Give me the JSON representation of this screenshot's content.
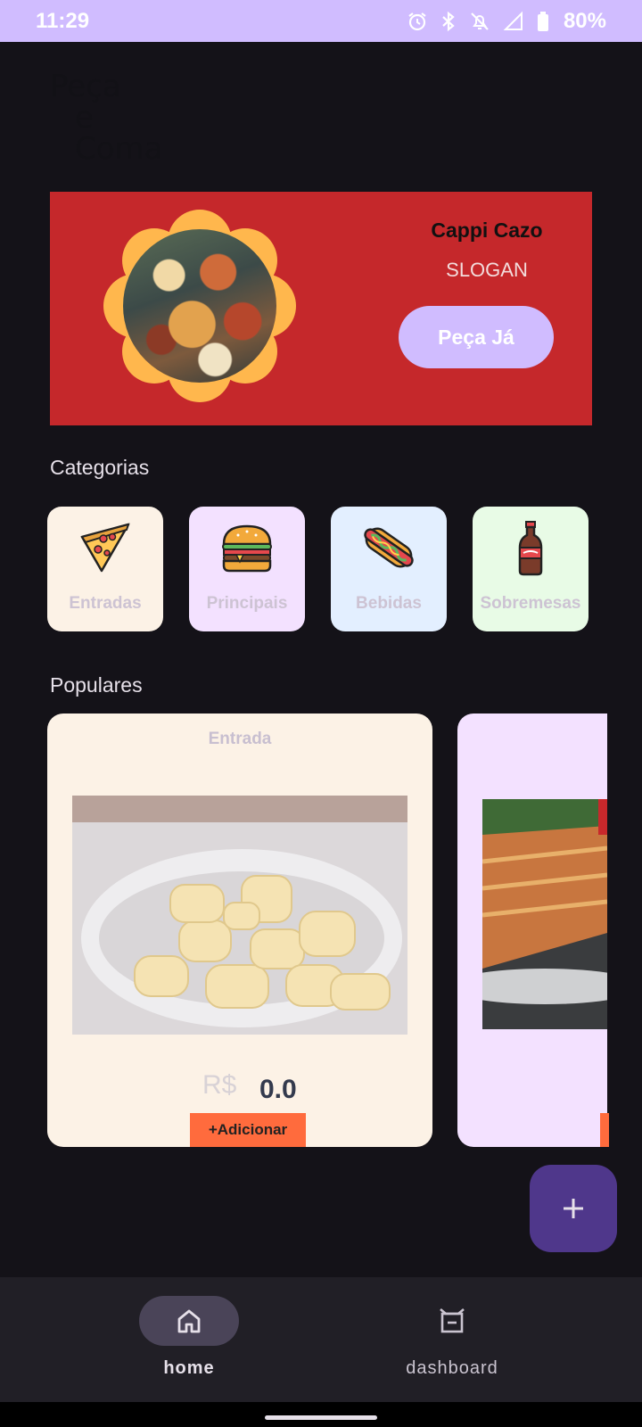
{
  "status_bar": {
    "time": "11:29",
    "battery": "80%",
    "icons": [
      "alarm-icon",
      "bluetooth-icon",
      "mute-icon",
      "signal-icon",
      "battery-icon"
    ]
  },
  "app": {
    "title_lines": [
      "Peça",
      "e",
      "Coma"
    ]
  },
  "banner": {
    "name": "Cappi Cazo",
    "slogan": "SLOGAN",
    "button_label": "Peça Já",
    "background": "#c5282b",
    "accent": "#ffb74d"
  },
  "categories": {
    "title": "Categorias",
    "items": [
      {
        "label": "Entradas",
        "icon": "pizza-icon",
        "color": "#fcf2e6"
      },
      {
        "label": "Principais",
        "icon": "burger-icon",
        "color": "#f3e1ff"
      },
      {
        "label": "Bebidas",
        "icon": "hotdog-icon",
        "color": "#e3efff"
      },
      {
        "label": "Sobremesas",
        "icon": "soda-bottle-icon",
        "color": "#e8fbe6"
      }
    ]
  },
  "populares": {
    "title": "Populares",
    "cards": [
      {
        "category": "Entrada",
        "currency": "R$",
        "price": "0.0",
        "button_label": "+Adicionar"
      },
      {
        "category": "",
        "currency": "",
        "price": "",
        "button_label": ""
      }
    ]
  },
  "bottom_nav": {
    "items": [
      {
        "label": "home",
        "icon": "home-icon",
        "selected": true
      },
      {
        "label": "dashboard",
        "icon": "dashboard-icon",
        "selected": false
      }
    ]
  },
  "colors": {
    "primary": "#d0bcff",
    "fab": "#4f378b",
    "add_button": "#ff6b3d",
    "background": "#141218"
  }
}
